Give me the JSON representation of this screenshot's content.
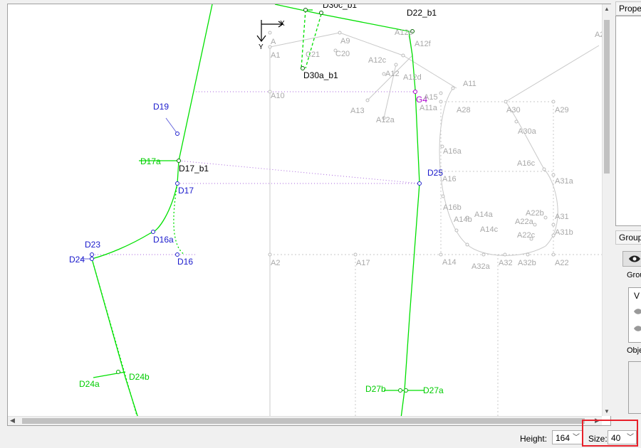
{
  "side_panel": {
    "properties_header": "Prope",
    "groups_header": "Group",
    "groups_label": "Grou",
    "group_list_header": "V",
    "objects_label": "Obje"
  },
  "status_bar": {
    "height_label": "Height:",
    "height_value": "164",
    "size_label": "Size:",
    "size_value": "40"
  },
  "axis": {
    "x_label": "X",
    "y_label": "Y"
  },
  "colors": {
    "green": "#00e000",
    "blue": "#0000cc",
    "gray": "#aaaaaa",
    "purple": "#aa00cc",
    "highlight": "#e8202a"
  },
  "points": {
    "green": [
      "D17a",
      "D24a",
      "D24b",
      "D27b",
      "D27a"
    ],
    "blue": [
      "D19",
      "D17",
      "D25",
      "D23",
      "D24",
      "D16a",
      "D16"
    ],
    "black": [
      "D30a_b1",
      "D22_b1",
      "D17_b1",
      "D30c_b1"
    ],
    "purple": [
      "G4"
    ],
    "gray": [
      "A",
      "A1",
      "A9",
      "C21",
      "C20",
      "A12c",
      "A12e",
      "A12f",
      "A12",
      "A12d",
      "A10",
      "A11",
      "A15",
      "A11a",
      "A13",
      "A12a",
      "A28",
      "A30",
      "A29",
      "A30a",
      "A16a",
      "A16c",
      "A16",
      "A31a",
      "A16b",
      "A14a",
      "A14b",
      "A22b",
      "A22a",
      "A31",
      "A14c",
      "A22c",
      "A31b",
      "A2",
      "A17",
      "A14",
      "A32a",
      "A32",
      "A32b",
      "A22",
      "A2"
    ]
  }
}
